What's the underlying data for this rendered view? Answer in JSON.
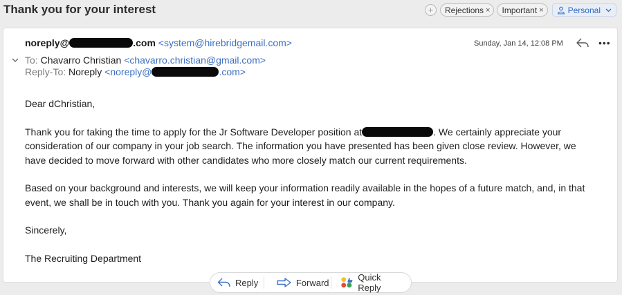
{
  "subject": "Thank you for your interest",
  "tags": {
    "add_symbol": "+",
    "items": [
      {
        "label": "Rejections",
        "remove": "×"
      },
      {
        "label": "Important",
        "remove": "×"
      }
    ],
    "category": "Personal",
    "chevron": "⌄"
  },
  "header": {
    "from_name": "noreply@",
    "from_suffix": ".com",
    "from_email": "<system@hirebridgemail.com>",
    "to_label": "To:",
    "to_name": "Chavarro Christian",
    "to_email": "<chavarro.christian@gmail.com>",
    "replyto_label": "Reply-To:",
    "replyto_name": "Noreply",
    "replyto_prefix": "<noreply@",
    "replyto_suffix": ".com>",
    "date": "Sunday, Jan 14, 12:08 PM",
    "more": "•••"
  },
  "body": {
    "greeting": "Dear dChristian,",
    "p1_a": "Thank you for taking the time to apply for the Jr Software Developer position at",
    "p1_b": ". We certainly appreciate your consideration of our company in your job search. The information you have presented has been given close review. However, we have decided to move forward with other candidates who more closely match our current requirements.",
    "p2": "Based on your background and interests, we will keep your information readily available in the hopes of a future match, and, in that event, we shall be in touch with you. Thank you again for your interest in our company.",
    "closing": "Sincerely,",
    "signature": "The Recruiting Department"
  },
  "actions": {
    "reply": "Reply",
    "forward": "Forward",
    "quick_reply": "Quick Reply"
  },
  "colors": {
    "link_blue": "#3a70c4",
    "category_blue": "#2e6ac7",
    "background": "#ececec"
  }
}
